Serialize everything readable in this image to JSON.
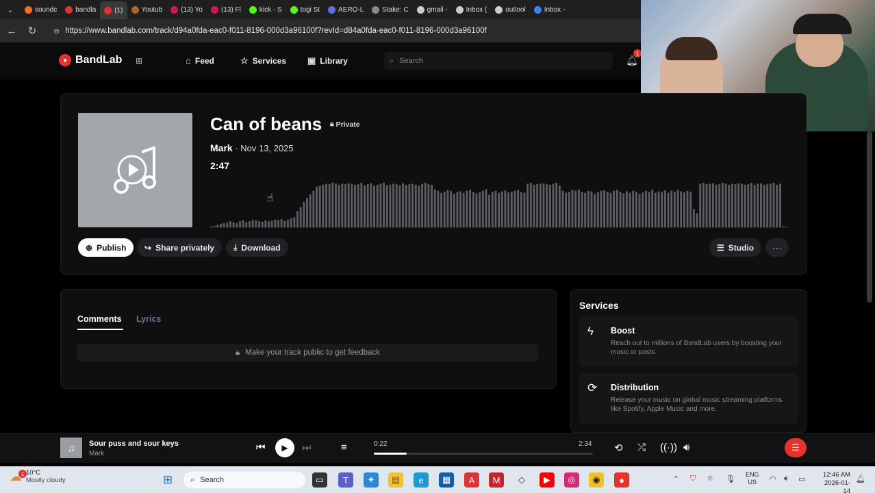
{
  "browser": {
    "tabs": [
      {
        "label": "soundc",
        "color": "#f26f23"
      },
      {
        "label": "bandla",
        "color": "#e6322b"
      },
      {
        "label": "(1)",
        "color": "#e6322b",
        "active": true
      },
      {
        "label": "Youtub",
        "color": "#b5651d"
      },
      {
        "label": "(13) Yo",
        "color": "#d4145a"
      },
      {
        "label": "(13) Fl",
        "color": "#d4145a"
      },
      {
        "label": "kick - S",
        "color": "#53fc18"
      },
      {
        "label": "togi St",
        "color": "#53fc18"
      },
      {
        "label": "AERO-L",
        "color": "#5a6cf0"
      },
      {
        "label": "Stake: C",
        "color": "#888888"
      },
      {
        "label": "gmail -",
        "color": "#cccccc"
      },
      {
        "label": "Inbox (",
        "color": "#cccccc"
      },
      {
        "label": "outlool",
        "color": "#cccccc"
      },
      {
        "label": "Inbox -",
        "color": "#3b82f6"
      }
    ],
    "url": "https://www.bandlab.com/track/d94a0fda-eac0-f011-8196-000d3a96100f?revId=d84a0fda-eac0-f011-8196-000d3a96100f"
  },
  "header": {
    "logo": "BandLab",
    "nav": {
      "feed": "Feed",
      "services": "Services",
      "library": "Library"
    },
    "search_placeholder": "Search",
    "notification_count": "1"
  },
  "track": {
    "title": "Can of beans",
    "visibility": "Private",
    "artist": "Mark",
    "date": "· Nov 13, 2025",
    "duration": "2:47",
    "actions": {
      "publish": "Publish",
      "share": "Share privately",
      "download": "Download",
      "studio": "Studio",
      "more": "···"
    },
    "waveform_levels": [
      0.02,
      0.03,
      0.05,
      0.07,
      0.08,
      0.09,
      0.12,
      0.1,
      0.08,
      0.12,
      0.14,
      0.1,
      0.12,
      0.15,
      0.14,
      0.12,
      0.11,
      0.14,
      0.12,
      0.13,
      0.15,
      0.14,
      0.16,
      0.13,
      0.15,
      0.18,
      0.2,
      0.32,
      0.4,
      0.5,
      0.58,
      0.65,
      0.72,
      0.8,
      0.82,
      0.84,
      0.86,
      0.85,
      0.88,
      0.86,
      0.84,
      0.86,
      0.85,
      0.87,
      0.86,
      0.84,
      0.85,
      0.88,
      0.83,
      0.85,
      0.87,
      0.82,
      0.84,
      0.86,
      0.88,
      0.83,
      0.84,
      0.86,
      0.85,
      0.83,
      0.87,
      0.84,
      0.85,
      0.86,
      0.84,
      0.82,
      0.86,
      0.88,
      0.85,
      0.84,
      0.75,
      0.72,
      0.68,
      0.7,
      0.74,
      0.72,
      0.66,
      0.7,
      0.71,
      0.68,
      0.72,
      0.74,
      0.7,
      0.67,
      0.69,
      0.72,
      0.75,
      0.64,
      0.7,
      0.72,
      0.68,
      0.71,
      0.73,
      0.69,
      0.7,
      0.72,
      0.74,
      0.7,
      0.68,
      0.86,
      0.88,
      0.84,
      0.85,
      0.86,
      0.87,
      0.85,
      0.84,
      0.86,
      0.88,
      0.83,
      0.72,
      0.68,
      0.7,
      0.74,
      0.72,
      0.75,
      0.7,
      0.68,
      0.72,
      0.71,
      0.66,
      0.69,
      0.72,
      0.73,
      0.7,
      0.68,
      0.72,
      0.74,
      0.7,
      0.67,
      0.71,
      0.68,
      0.72,
      0.7,
      0.66,
      0.69,
      0.72,
      0.7,
      0.74,
      0.68,
      0.71,
      0.7,
      0.73,
      0.68,
      0.72,
      0.7,
      0.74,
      0.71,
      0.69,
      0.72,
      0.7,
      0.36,
      0.28,
      0.86,
      0.88,
      0.85,
      0.86,
      0.87,
      0.84,
      0.85,
      0.88,
      0.86,
      0.84,
      0.86,
      0.85,
      0.87,
      0.86,
      0.84,
      0.85,
      0.88,
      0.84,
      0.86,
      0.87,
      0.84,
      0.85,
      0.86,
      0.88,
      0.84,
      0.86,
      0.02,
      0.01
    ]
  },
  "comments": {
    "tabs": [
      "Comments",
      "Lyrics"
    ],
    "notice": "Make your track public to get feedback"
  },
  "services": {
    "title": "Services",
    "items": [
      {
        "title": "Boost",
        "desc": "Reach out to millions of BandLab users by boosting your music or posts."
      },
      {
        "title": "Distribution",
        "desc": "Release your music on global music streaming platforms like Spotify, Apple Music and more."
      }
    ]
  },
  "player": {
    "title": "Sour puss and sour keys",
    "artist": "Mark",
    "current": "0:22",
    "total": "2:34",
    "progress": 0.15
  },
  "taskbar": {
    "temp": "10°C",
    "condition": "Mostly cloudy",
    "weather_badge": "1",
    "search": "Search",
    "lang_1": "ENG",
    "lang_2": "US",
    "time": "12:46 AM",
    "date": "2026-01-14"
  },
  "colors": {
    "brand": "#e6322b",
    "background": "#000000",
    "panel": "#0f0f10"
  }
}
